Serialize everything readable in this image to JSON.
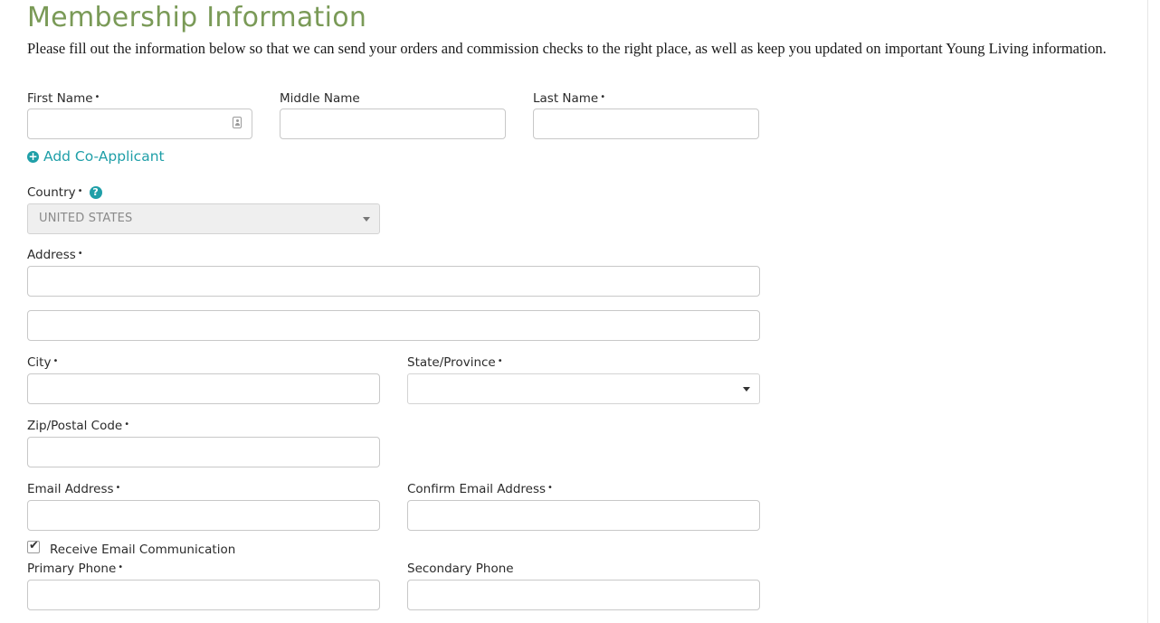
{
  "header": {
    "title": "Membership Information",
    "intro": "Please fill out the information below so that we can send your orders and commission checks to the right place, as well as keep you updated on important Young Living information."
  },
  "required_marker": "•",
  "name": {
    "first_label": "First Name",
    "middle_label": "Middle Name",
    "last_label": "Last Name",
    "first_value": "",
    "middle_value": "",
    "last_value": ""
  },
  "co_applicant": {
    "icon": "plus-circle-icon",
    "label": "Add Co-Applicant"
  },
  "country": {
    "label": "Country",
    "help_icon": "question-circle-icon",
    "help_glyph": "?",
    "selected": "UNITED STATES",
    "disabled": true
  },
  "address": {
    "label": "Address",
    "line1": "",
    "line2": ""
  },
  "city": {
    "label": "City",
    "value": ""
  },
  "state": {
    "label": "State/Province",
    "selected": ""
  },
  "zip": {
    "label": "Zip/Postal Code",
    "value": ""
  },
  "email": {
    "label": "Email Address",
    "confirm_label": "Confirm Email Address",
    "value": "",
    "confirm_value": ""
  },
  "receive_email": {
    "label": "Receive Email Communication",
    "checked": true
  },
  "phone": {
    "primary_label": "Primary Phone",
    "secondary_label": "Secondary Phone",
    "primary_value": "",
    "secondary_value": ""
  },
  "colors": {
    "title": "#7a9a57",
    "link": "#1f9fa8",
    "disabled_bg": "#efefef",
    "border": "#c8c8c8"
  }
}
